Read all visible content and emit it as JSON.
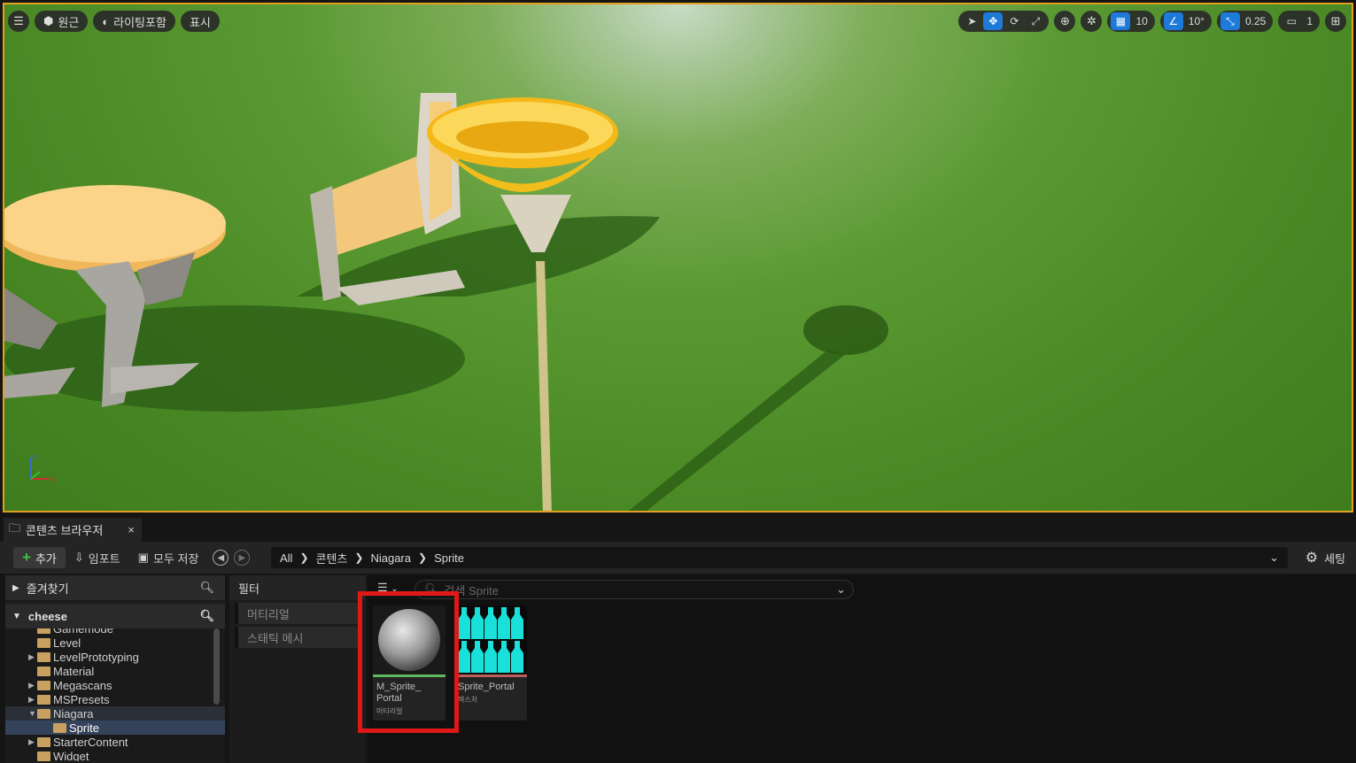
{
  "viewport": {
    "perspective_label": "원근",
    "lighting_label": "라이팅포함",
    "show_label": "표시",
    "grid_snap_value": "10",
    "rotation_snap_value": "10°",
    "scale_snap_value": "0.25",
    "camera_speed_value": "1"
  },
  "tab": {
    "title": "콘텐츠 브라우저",
    "close": "×"
  },
  "toolbar": {
    "add_label": "추가",
    "import_label": "임포트",
    "save_all_label": "모두 저장",
    "settings_label": "세팅",
    "breadcrumbs": [
      "All",
      "콘텐츠",
      "Niagara",
      "Sprite"
    ]
  },
  "left_panel": {
    "favorites_label": "즐겨찾기",
    "project_label": "cheese",
    "tree": [
      {
        "label": "Gamemode",
        "arrow": "",
        "indent": 0
      },
      {
        "label": "Level",
        "arrow": "",
        "indent": 0
      },
      {
        "label": "LevelPrototyping",
        "arrow": "▶",
        "indent": 0
      },
      {
        "label": "Material",
        "arrow": "",
        "indent": 0
      },
      {
        "label": "Megascans",
        "arrow": "▶",
        "indent": 0
      },
      {
        "label": "MSPresets",
        "arrow": "▶",
        "indent": 0
      },
      {
        "label": "Niagara",
        "arrow": "▼",
        "indent": 0
      },
      {
        "label": "Sprite",
        "arrow": "",
        "indent": 1
      },
      {
        "label": "StarterContent",
        "arrow": "▶",
        "indent": 0
      },
      {
        "label": "Widget",
        "arrow": "",
        "indent": 0
      }
    ]
  },
  "filter_panel": {
    "title": "필터",
    "items": [
      "머티리얼",
      "스태틱 메시"
    ]
  },
  "assets": {
    "search_placeholder": "검색 Sprite",
    "items": [
      {
        "name_line1": "M_Sprite_",
        "name_line2": "Portal",
        "type": "머티리얼",
        "bar_color": "#5fb85f"
      },
      {
        "name_line1": "Sprite_Portal",
        "name_line2": "",
        "type": "텍스처",
        "bar_color": "#b85f5f"
      }
    ]
  }
}
